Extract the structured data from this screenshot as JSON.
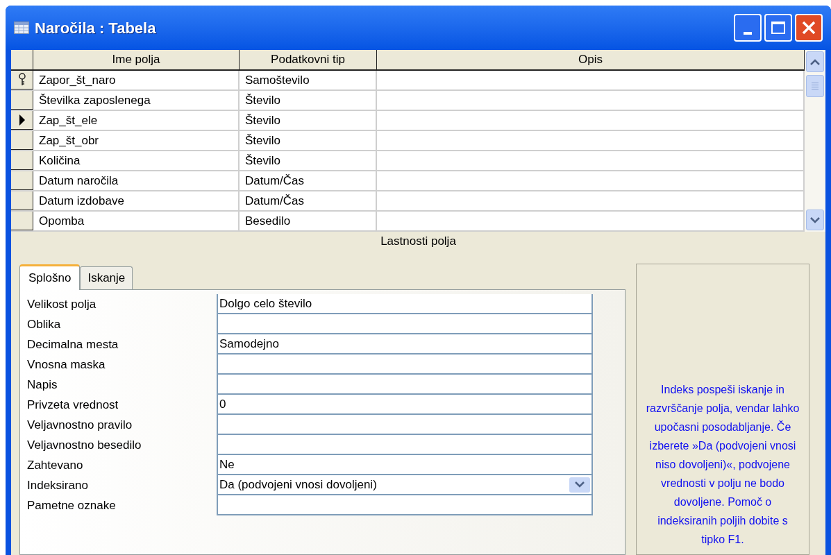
{
  "window": {
    "title": "Naročila : Tabela"
  },
  "grid": {
    "columns": [
      "Ime polja",
      "Podatkovni tip",
      "Opis"
    ],
    "rows": [
      {
        "name": "Zapor_št_naro",
        "type": "Samoštevilo",
        "primary_key": true,
        "selected": false
      },
      {
        "name": "Številka zaposlenega",
        "type": "Število",
        "primary_key": false,
        "selected": false
      },
      {
        "name": "Zap_št_ele",
        "type": "Število",
        "primary_key": false,
        "selected": true
      },
      {
        "name": "Zap_št_obr",
        "type": "Število",
        "primary_key": false,
        "selected": false
      },
      {
        "name": "Količina",
        "type": "Število",
        "primary_key": false,
        "selected": false
      },
      {
        "name": "Datum naročila",
        "type": "Datum/Čas",
        "primary_key": false,
        "selected": false
      },
      {
        "name": "Datum izdobave",
        "type": "Datum/Čas",
        "primary_key": false,
        "selected": false
      },
      {
        "name": "Opomba",
        "type": "Besedilo",
        "primary_key": false,
        "selected": false
      }
    ]
  },
  "properties_heading": "Lastnosti polja",
  "tabs": [
    {
      "label": "Splošno",
      "selected": true
    },
    {
      "label": "Iskanje",
      "selected": false
    }
  ],
  "properties": [
    {
      "label": "Velikost polja",
      "value": "Dolgo celo število",
      "kind": "text"
    },
    {
      "label": "Oblika",
      "kind": "text"
    },
    {
      "label": "Decimalna mesta",
      "value": "Samodejno",
      "kind": "text"
    },
    {
      "label": "Vnosna maska",
      "kind": "text"
    },
    {
      "label": "Napis",
      "kind": "text"
    },
    {
      "label": "Privzeta vrednost",
      "value": "0",
      "kind": "text"
    },
    {
      "label": "Veljavnostno pravilo",
      "kind": "text"
    },
    {
      "label": "Veljavnostno besedilo",
      "kind": "text"
    },
    {
      "label": "Zahtevano",
      "value": "Ne",
      "kind": "text"
    },
    {
      "label": "Indeksirano",
      "value": "Da (podvojeni vnosi dovoljeni)",
      "kind": "dropdown"
    },
    {
      "label": "Pametne oznake",
      "kind": "text"
    }
  ],
  "help_text": "Indeks pospeši iskanje in razvrščanje polja, vendar lahko upočasni posodabljanje. Če izberete »Da (podvojeni vnosi niso dovoljeni)«, podvojene vrednosti v polju ne bodo dovoljene. Pomoč o indeksiranih poljih dobite s tipko F1."
}
